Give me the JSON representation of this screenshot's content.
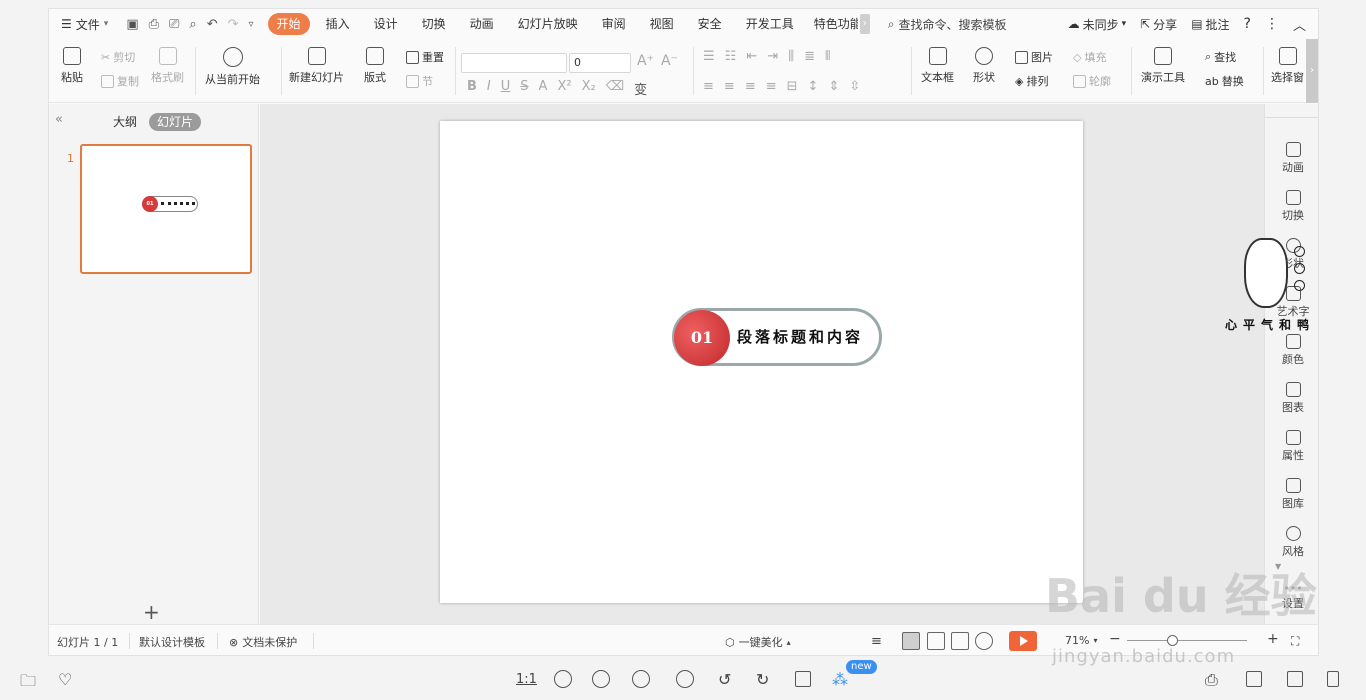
{
  "menubar": {
    "file_label": "文件",
    "tabs": [
      "开始",
      "插入",
      "设计",
      "切换",
      "动画",
      "幻灯片放映",
      "审阅",
      "视图",
      "安全",
      "开发工具",
      "特色功能"
    ],
    "active_tab": "开始",
    "search_placeholder": "查找命令、搜索模板",
    "sync_label": "未同步",
    "share_label": "分享",
    "comment_label": "批注"
  },
  "ribbon": {
    "paste": "粘贴",
    "cut": "剪切",
    "copy": "复制",
    "format_painter": "格式刷",
    "play_from_current": "从当前开始",
    "new_slide": "新建幻灯片",
    "layout": "版式",
    "reset": "重置",
    "section": "节",
    "font_size": "0",
    "text_box": "文本框",
    "shape": "形状",
    "picture": "图片",
    "arrange": "排列",
    "fill": "填充",
    "outline": "轮廓",
    "presenter_tools": "演示工具",
    "find": "查找",
    "replace": "替换",
    "select_pane": "选择窗"
  },
  "left_pane": {
    "outline_tab": "大纲",
    "slides_tab": "幻灯片",
    "slide_number": "1",
    "thumb_num": "01"
  },
  "slide": {
    "number": "01",
    "heading": "段落标题和内容"
  },
  "right_sidebar": {
    "items": [
      "动画",
      "切换",
      "形状",
      "艺术字",
      "颜色",
      "图表",
      "属性",
      "图库",
      "风格",
      "设置"
    ]
  },
  "duck_caption": "心平气和鸭",
  "statusbar": {
    "slide_info": "幻灯片 1 / 1",
    "template": "默认设计模板",
    "protection": "文档未保护",
    "beautify": "一键美化",
    "zoom": "71%"
  },
  "viewer": {
    "ratio_label": "1:1",
    "new_badge": "new"
  },
  "watermark": {
    "main": "Bai du 经验",
    "sub": "jingyan.baidu.com"
  }
}
